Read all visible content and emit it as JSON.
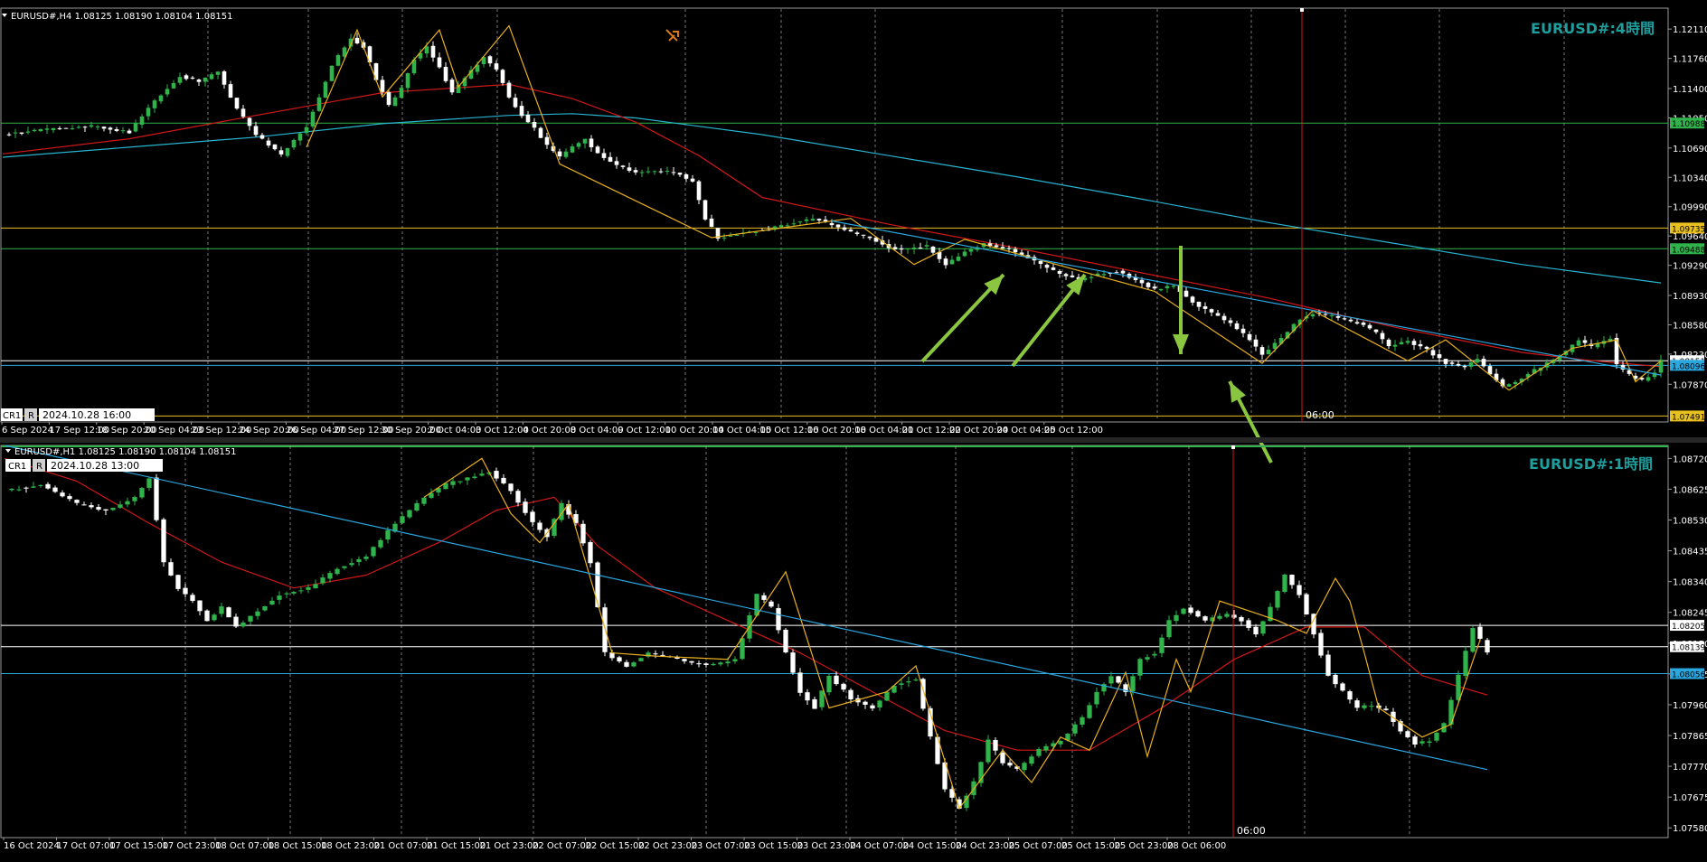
{
  "colors": {
    "background": "#000000",
    "bull_candle": "#2fb34a",
    "bear_candle": "#ffffff",
    "ma_short": "#d01818",
    "ma_long": "#28b4d0",
    "zigzag": "#e8b020",
    "trendline": "#2ba7e0",
    "annotation_arrow": "#8ac640",
    "time_marker": "#d01818",
    "title": "#1f9e9e",
    "hline_green": "#2fb34a",
    "hline_yellow": "#e8c020",
    "hline_blue": "#2ba7e0",
    "hline_white": "#ffffff"
  },
  "chart_data": [
    {
      "type": "candlestick",
      "title": "EURUSD#:4時間",
      "info": "EURUSD#,H4  1.08125 1.08190 1.08104 1.08151",
      "window_label": "CR1",
      "window_button": "R",
      "window_date": "2024.10.28 16:00",
      "marker_label": "06:00",
      "ylim": [
        1.0742,
        1.1236
      ],
      "yticks": [
        "1.12110",
        "1.11760",
        "1.11400",
        "1.11050",
        "1.10690",
        "1.10340",
        "1.09990",
        "1.09640",
        "1.09290",
        "1.08930",
        "1.08580",
        "1.08230",
        "1.07870"
      ],
      "xticks": [
        "6 Sep 2024",
        "17 Sep 12:00",
        "18 Sep 20:00",
        "20 Sep 04:00",
        "23 Sep 12:00",
        "24 Sep 20:00",
        "26 Sep 04:00",
        "27 Sep 12:00",
        "30 Sep 20:00",
        "2 Oct 04:00",
        "3 Oct 12:00",
        "4 Oct 20:00",
        "8 Oct 04:00",
        "9 Oct 12:00",
        "10 Oct 20:00",
        "14 Oct 04:00",
        "15 Oct 12:00",
        "16 Oct 20:00",
        "18 Oct 04:00",
        "21 Oct 12:00",
        "22 Oct 20:00",
        "24 Oct 04:00",
        "25 Oct 12:00"
      ],
      "price_lines": [
        {
          "value": 1.10988,
          "label": "1.10988",
          "color": "green"
        },
        {
          "value": 1.09735,
          "label": "1.09735",
          "color": "yellow"
        },
        {
          "value": 1.09488,
          "label": "1.09488",
          "color": "green"
        },
        {
          "value": 1.08151,
          "label": "1.08151",
          "color": "white"
        },
        {
          "value": 1.08096,
          "label": "1.08096",
          "color": "blue"
        },
        {
          "value": 1.07491,
          "label": "1.07491",
          "color": "yellow"
        }
      ],
      "close_path": [
        [
          0,
          1.1085
        ],
        [
          8,
          1.1092
        ],
        [
          14,
          1.1095
        ],
        [
          20,
          1.1088
        ],
        [
          24,
          1.1125
        ],
        [
          28,
          1.1155
        ],
        [
          31,
          1.1148
        ],
        [
          34,
          1.116
        ],
        [
          37,
          1.1115
        ],
        [
          40,
          1.1085
        ],
        [
          44,
          1.106
        ],
        [
          48,
          1.1095
        ],
        [
          50,
          1.113
        ],
        [
          52,
          1.1168
        ],
        [
          55,
          1.12
        ],
        [
          57,
          1.119
        ],
        [
          59,
          1.115
        ],
        [
          61,
          1.112
        ],
        [
          63,
          1.114
        ],
        [
          65,
          1.1175
        ],
        [
          67,
          1.119
        ],
        [
          69,
          1.1165
        ],
        [
          71,
          1.1135
        ],
        [
          73,
          1.1152
        ],
        [
          76,
          1.1178
        ],
        [
          78,
          1.1162
        ],
        [
          80,
          1.113
        ],
        [
          82,
          1.1108
        ],
        [
          84,
          1.1092
        ],
        [
          86,
          1.1072
        ],
        [
          88,
          1.1058
        ],
        [
          90,
          1.107
        ],
        [
          92,
          1.108
        ],
        [
          94,
          1.1062
        ],
        [
          97,
          1.1048
        ],
        [
          100,
          1.104
        ],
        [
          103,
          1.1042
        ],
        [
          106,
          1.104
        ],
        [
          109,
          1.103
        ],
        [
          111,
          1.0985
        ],
        [
          113,
          1.0962
        ],
        [
          116,
          1.0966
        ],
        [
          119,
          1.097
        ],
        [
          122,
          1.0974
        ],
        [
          125,
          1.098
        ],
        [
          128,
          1.0985
        ],
        [
          131,
          1.0978
        ],
        [
          134,
          1.0968
        ],
        [
          137,
          1.0962
        ],
        [
          140,
          1.095
        ],
        [
          143,
          1.0948
        ],
        [
          146,
          1.0952
        ],
        [
          149,
          1.093
        ],
        [
          152,
          1.0945
        ],
        [
          155,
          1.0955
        ],
        [
          158,
          1.095
        ],
        [
          161,
          1.0942
        ],
        [
          164,
          1.093
        ],
        [
          167,
          1.0918
        ],
        [
          170,
          1.0912
        ],
        [
          173,
          1.0918
        ],
        [
          176,
          1.0922
        ],
        [
          179,
          1.0912
        ],
        [
          182,
          1.09
        ],
        [
          185,
          1.0905
        ],
        [
          188,
          1.0885
        ],
        [
          191,
          1.0872
        ],
        [
          194,
          1.086
        ],
        [
          197,
          1.084
        ],
        [
          199,
          1.0822
        ],
        [
          201,
          1.0835
        ],
        [
          203,
          1.085
        ],
        [
          205,
          1.0865
        ],
        [
          207,
          1.0872
        ],
        [
          210,
          1.0868
        ],
        [
          213,
          1.0862
        ],
        [
          215,
          1.0858
        ],
        [
          217,
          1.0848
        ],
        [
          219,
          1.0832
        ],
        [
          222,
          1.0838
        ],
        [
          225,
          1.0828
        ],
        [
          228,
          1.0812
        ],
        [
          231,
          1.0808
        ],
        [
          233,
          1.0818
        ],
        [
          235,
          1.08
        ],
        [
          237,
          1.0784
        ],
        [
          239,
          1.079
        ],
        [
          241,
          1.08
        ],
        [
          244,
          1.0812
        ],
        [
          247,
          1.0826
        ],
        [
          249,
          1.084
        ],
        [
          251,
          1.0832
        ],
        [
          253,
          1.0838
        ],
        [
          254,
          1.0842
        ],
        [
          255,
          1.081
        ],
        [
          257,
          1.0798
        ],
        [
          259,
          1.0792
        ],
        [
          261,
          1.08
        ],
        [
          262,
          1.0815
        ]
      ],
      "ma_short": [
        [
          0,
          1.1062
        ],
        [
          20,
          1.108
        ],
        [
          40,
          1.1108
        ],
        [
          60,
          1.1135
        ],
        [
          80,
          1.1145
        ],
        [
          90,
          1.1128
        ],
        [
          100,
          1.11
        ],
        [
          110,
          1.106
        ],
        [
          120,
          1.101
        ],
        [
          140,
          1.0978
        ],
        [
          160,
          1.095
        ],
        [
          180,
          1.092
        ],
        [
          200,
          1.089
        ],
        [
          210,
          1.0872
        ],
        [
          220,
          1.0855
        ],
        [
          230,
          1.084
        ],
        [
          240,
          1.0825
        ],
        [
          250,
          1.0816
        ],
        [
          262,
          1.0808
        ]
      ],
      "ma_long": [
        [
          0,
          1.1058
        ],
        [
          20,
          1.107
        ],
        [
          40,
          1.1082
        ],
        [
          60,
          1.1098
        ],
        [
          80,
          1.1108
        ],
        [
          90,
          1.111
        ],
        [
          100,
          1.1105
        ],
        [
          120,
          1.1085
        ],
        [
          140,
          1.106
        ],
        [
          160,
          1.1035
        ],
        [
          180,
          1.1008
        ],
        [
          200,
          1.098
        ],
        [
          220,
          1.0955
        ],
        [
          240,
          1.093
        ],
        [
          262,
          1.0908
        ]
      ],
      "zigzag": [
        [
          48,
          1.107
        ],
        [
          56,
          1.121
        ],
        [
          60,
          1.113
        ],
        [
          69,
          1.121
        ],
        [
          72,
          1.1142
        ],
        [
          80,
          1.1215
        ],
        [
          88,
          1.105
        ],
        [
          112,
          1.0962
        ],
        [
          134,
          1.0985
        ],
        [
          144,
          1.093
        ],
        [
          152,
          1.096
        ],
        [
          182,
          1.0898
        ],
        [
          199,
          1.0812
        ],
        [
          207,
          1.0875
        ],
        [
          222,
          1.0815
        ],
        [
          228,
          1.084
        ],
        [
          238,
          1.078
        ],
        [
          248,
          1.083
        ],
        [
          255,
          1.084
        ],
        [
          258,
          1.079
        ],
        [
          262,
          1.0815
        ]
      ],
      "trendline": [
        [
          131,
          1.0982
        ],
        [
          262,
          1.0798
        ]
      ],
      "arrows": [
        [
          1020,
          400,
          1110,
          304
        ],
        [
          1120,
          405,
          1200,
          304
        ],
        [
          1306,
          272,
          1306,
          392
        ],
        [
          1406,
          512,
          1360,
          422
        ]
      ],
      "marker_x": 1440
    },
    {
      "type": "candlestick",
      "title": "EURUSD#:1時間",
      "info": "EURUSD#,H1  1.08125 1.08190 1.08104 1.08151",
      "window_label": "CR1",
      "window_button": "R",
      "window_date": "2024.10.28 13:00",
      "marker_label": "06:00",
      "ylim": [
        1.0755,
        1.0876
      ],
      "yticks": [
        "1.08720",
        "1.08625",
        "1.08530",
        "1.08435",
        "1.08340",
        "1.08245",
        "1.08150",
        "1.08055",
        "1.07960",
        "1.07865",
        "1.07770",
        "1.07675",
        "1.07580"
      ],
      "xticks": [
        "16 Oct 2024",
        "17 Oct 07:00",
        "17 Oct 15:00",
        "17 Oct 23:00",
        "18 Oct 07:00",
        "18 Oct 15:00",
        "18 Oct 23:00",
        "21 Oct 07:00",
        "21 Oct 15:00",
        "21 Oct 23:00",
        "22 Oct 07:00",
        "22 Oct 15:00",
        "22 Oct 23:00",
        "23 Oct 07:00",
        "23 Oct 15:00",
        "23 Oct 23:00",
        "24 Oct 07:00",
        "24 Oct 15:00",
        "24 Oct 23:00",
        "25 Oct 07:00",
        "25 Oct 15:00",
        "25 Oct 23:00",
        "28 Oct 06:00"
      ],
      "price_lines": [
        {
          "value": 1.08205,
          "label": "1.08205",
          "color": "white"
        },
        {
          "value": 1.08139,
          "label": "1.08139",
          "color": "white"
        },
        {
          "value": 1.08056,
          "label": "1.08056",
          "color": "blue"
        }
      ],
      "close_path": [
        [
          0,
          1.0862
        ],
        [
          5,
          1.0864
        ],
        [
          10,
          1.0858
        ],
        [
          14,
          1.0856
        ],
        [
          18,
          1.086
        ],
        [
          20,
          1.0866
        ],
        [
          22,
          1.084
        ],
        [
          24,
          1.0832
        ],
        [
          26,
          1.0828
        ],
        [
          28,
          1.0822
        ],
        [
          30,
          1.0826
        ],
        [
          32,
          1.082
        ],
        [
          35,
          1.0825
        ],
        [
          38,
          1.083
        ],
        [
          42,
          1.0832
        ],
        [
          46,
          1.0838
        ],
        [
          50,
          1.0842
        ],
        [
          54,
          1.0852
        ],
        [
          58,
          1.086
        ],
        [
          61,
          1.0864
        ],
        [
          64,
          1.0866
        ],
        [
          67,
          1.0868
        ],
        [
          70,
          1.0862
        ],
        [
          73,
          1.0852
        ],
        [
          75,
          1.0848
        ],
        [
          77,
          1.0858
        ],
        [
          79,
          1.0852
        ],
        [
          81,
          1.084
        ],
        [
          83,
          1.0812
        ],
        [
          86,
          1.0808
        ],
        [
          89,
          1.0812
        ],
        [
          93,
          1.081
        ],
        [
          97,
          1.0808
        ],
        [
          101,
          1.081
        ],
        [
          104,
          1.083
        ],
        [
          106,
          1.0826
        ],
        [
          108,
          1.0812
        ],
        [
          110,
          1.08
        ],
        [
          112,
          1.0795
        ],
        [
          114,
          1.0805
        ],
        [
          117,
          1.0798
        ],
        [
          120,
          1.0795
        ],
        [
          123,
          1.0802
        ],
        [
          126,
          1.0804
        ],
        [
          128,
          1.0786
        ],
        [
          130,
          1.077
        ],
        [
          132,
          1.0764
        ],
        [
          134,
          1.0772
        ],
        [
          136,
          1.0785
        ],
        [
          138,
          1.0778
        ],
        [
          140,
          1.0776
        ],
        [
          143,
          1.0782
        ],
        [
          146,
          1.0785
        ],
        [
          149,
          1.0792
        ],
        [
          151,
          1.08
        ],
        [
          153,
          1.0805
        ],
        [
          155,
          1.08
        ],
        [
          157,
          1.081
        ],
        [
          159,
          1.0812
        ],
        [
          161,
          1.0822
        ],
        [
          163,
          1.0826
        ],
        [
          166,
          1.0822
        ],
        [
          169,
          1.0824
        ],
        [
          171,
          1.0822
        ],
        [
          173,
          1.0818
        ],
        [
          175,
          1.0826
        ],
        [
          177,
          1.0836
        ],
        [
          179,
          1.083
        ],
        [
          181,
          1.0818
        ],
        [
          183,
          1.0805
        ],
        [
          185,
          1.08
        ],
        [
          187,
          1.0795
        ],
        [
          189,
          1.0796
        ],
        [
          191,
          1.0794
        ],
        [
          193,
          1.0788
        ],
        [
          195,
          1.0784
        ],
        [
          197,
          1.0785
        ],
        [
          199,
          1.079
        ],
        [
          201,
          1.0805
        ],
        [
          203,
          1.082
        ],
        [
          205,
          1.0812
        ]
      ],
      "ma_short": [
        [
          0,
          1.0872
        ],
        [
          10,
          1.0865
        ],
        [
          20,
          1.0852
        ],
        [
          30,
          1.084
        ],
        [
          40,
          1.0832
        ],
        [
          50,
          1.0836
        ],
        [
          60,
          1.0846
        ],
        [
          68,
          1.0856
        ],
        [
          76,
          1.086
        ],
        [
          82,
          1.0845
        ],
        [
          90,
          1.0832
        ],
        [
          100,
          1.0822
        ],
        [
          110,
          1.0812
        ],
        [
          120,
          1.08
        ],
        [
          130,
          1.0788
        ],
        [
          140,
          1.0782
        ],
        [
          150,
          1.0782
        ],
        [
          160,
          1.0795
        ],
        [
          170,
          1.081
        ],
        [
          180,
          1.082
        ],
        [
          188,
          1.082
        ],
        [
          196,
          1.0805
        ],
        [
          205,
          1.0799
        ]
      ],
      "zigzag": [
        [
          58,
          1.086
        ],
        [
          66,
          1.0872
        ],
        [
          70,
          1.0855
        ],
        [
          74,
          1.0846
        ],
        [
          78,
          1.0858
        ],
        [
          84,
          1.0812
        ],
        [
          90,
          1.0811
        ],
        [
          100,
          1.081
        ],
        [
          108,
          1.0837
        ],
        [
          114,
          1.0795
        ],
        [
          122,
          1.08
        ],
        [
          126,
          1.0808
        ],
        [
          132,
          1.0764
        ],
        [
          138,
          1.0782
        ],
        [
          142,
          1.0772
        ],
        [
          146,
          1.0786
        ],
        [
          150,
          1.0782
        ],
        [
          155,
          1.0806
        ],
        [
          158,
          1.078
        ],
        [
          162,
          1.081
        ],
        [
          164,
          1.08
        ],
        [
          168,
          1.0828
        ],
        [
          176,
          1.0822
        ],
        [
          180,
          1.0818
        ],
        [
          184,
          1.0835
        ],
        [
          186,
          1.0828
        ],
        [
          188,
          1.0812
        ],
        [
          190,
          1.0795
        ],
        [
          196,
          1.0786
        ],
        [
          200,
          1.079
        ],
        [
          204,
          1.0816
        ]
      ],
      "trendline": [
        [
          0,
          1.0876
        ],
        [
          205,
          1.0776
        ]
      ],
      "arrows": [],
      "marker_x": 1364
    }
  ]
}
